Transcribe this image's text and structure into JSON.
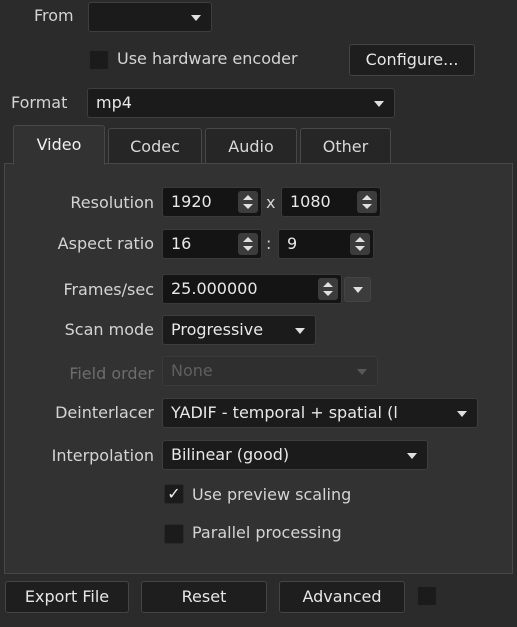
{
  "from": {
    "label": "From",
    "value": ""
  },
  "hardware_encoder": {
    "label": "Use hardware encoder",
    "checked": false,
    "configure_label": "Configure..."
  },
  "format": {
    "label": "Format",
    "value": "mp4"
  },
  "tabs": [
    {
      "label": "Video",
      "active": true
    },
    {
      "label": "Codec",
      "active": false
    },
    {
      "label": "Audio",
      "active": false
    },
    {
      "label": "Other",
      "active": false
    }
  ],
  "video": {
    "resolution": {
      "label": "Resolution",
      "width": "1920",
      "sep": "x",
      "height": "1080"
    },
    "aspect": {
      "label": "Aspect ratio",
      "num": "16",
      "sep": ":",
      "den": "9"
    },
    "fps": {
      "label": "Frames/sec",
      "value": "25.000000"
    },
    "scan_mode": {
      "label": "Scan mode",
      "value": "Progressive"
    },
    "field_order": {
      "label": "Field order",
      "value": "None",
      "enabled": false
    },
    "deinterlacer": {
      "label": "Deinterlacer",
      "value": "YADIF - temporal + spatial (l"
    },
    "interpolation": {
      "label": "Interpolation",
      "value": "Bilinear (good)"
    },
    "preview_scaling": {
      "label": "Use preview scaling",
      "checked": true,
      "mark": "✓"
    },
    "parallel": {
      "label": "Parallel processing",
      "checked": false
    }
  },
  "footer": {
    "export_label": "Export File",
    "reset_label": "Reset",
    "advanced_label": "Advanced"
  },
  "colors": {
    "background": "#2b2b2b",
    "panel": "#323232",
    "field": "#1b1b1b",
    "text": "#d8d8d8"
  }
}
